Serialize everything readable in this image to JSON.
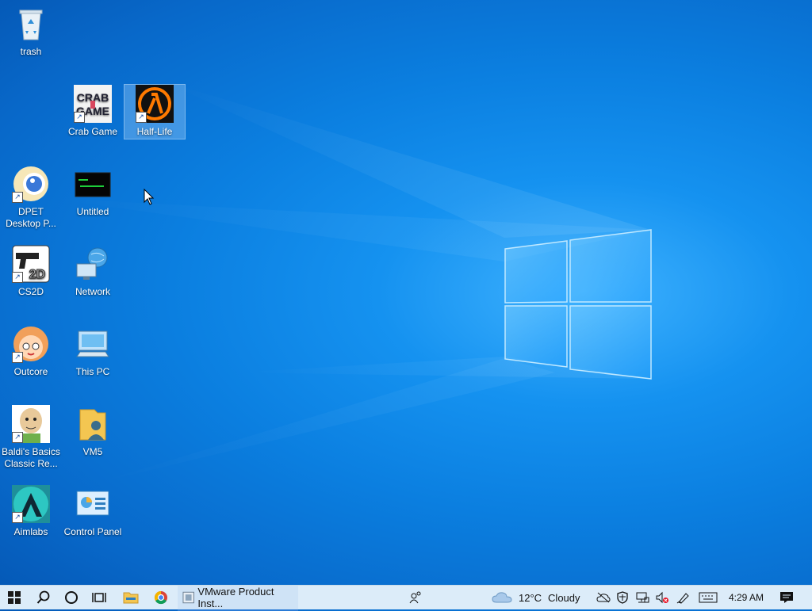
{
  "desktop": {
    "icons": [
      {
        "id": "trash",
        "label": "trash"
      },
      {
        "id": "crab-game",
        "label": "Crab Game"
      },
      {
        "id": "half-life",
        "label": "Half-Life"
      },
      {
        "id": "dpet",
        "label": "DPET\nDesktop P..."
      },
      {
        "id": "untitled",
        "label": "Untitled"
      },
      {
        "id": "cs2d",
        "label": "CS2D"
      },
      {
        "id": "network",
        "label": "Network"
      },
      {
        "id": "outcore",
        "label": "Outcore"
      },
      {
        "id": "this-pc",
        "label": "This PC"
      },
      {
        "id": "baldi",
        "label": "Baldi's Basics\nClassic Re..."
      },
      {
        "id": "vm5",
        "label": "VM5"
      },
      {
        "id": "aimlabs",
        "label": "Aimlabs"
      },
      {
        "id": "control-panel",
        "label": "Control Panel"
      }
    ],
    "crab_logo_line1": "CRAB",
    "crab_logo_line2": "GAME",
    "cs2d_badge": "2D",
    "selected": "Half-Life"
  },
  "taskbar": {
    "vmware_label": "VMware Product Inst...",
    "weather_temp": "12°C",
    "weather_cond": "Cloudy",
    "clock": "4:29 AM"
  },
  "colors": {
    "taskbar_bg": "#dcecf9",
    "accent": "#2a7bd6",
    "desktop_bg": "#0b7fe0"
  }
}
